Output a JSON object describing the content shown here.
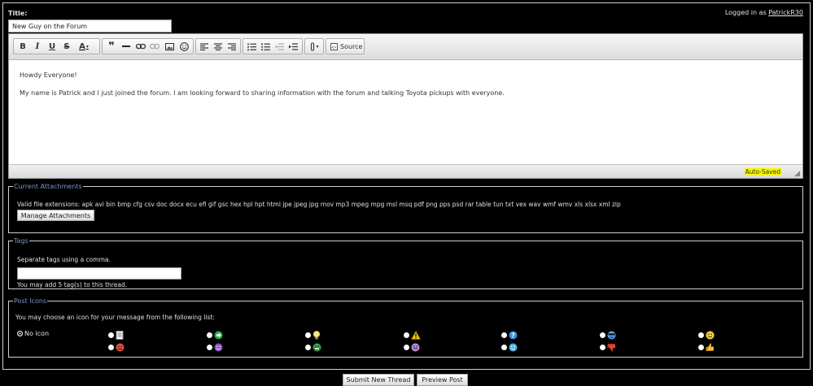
{
  "title_label": "Title:",
  "title_value": "New Guy on the Forum",
  "logged_in_prefix": "Logged in as",
  "username": "PatrickR30",
  "toolbar": {
    "bold": "B",
    "italic": "I",
    "underline": "U",
    "strike": "S",
    "color": "A",
    "quote": "❞",
    "source_label": "Source"
  },
  "editor": {
    "paragraphs": [
      "Howdy Everyone!",
      "My name is Patrick and I just joined the forum. I am looking forward to sharing information with the forum and talking Toyota pickups with everyone."
    ],
    "status": "Auto-Saved"
  },
  "attachments": {
    "legend": "Current Attachments",
    "extensions": "Valid file extensions: apk avi bin bmp cfg csv doc docx ecu efi gif gsc hex hpl hpt html jpe jpeg jpg mov mp3 mpeg mpg msl msq pdf png pps psd rar table tun txt vex wav wmf wmv xls xlsx xml zip",
    "manage_label": "Manage Attachments"
  },
  "tags": {
    "legend": "Tags",
    "hint": "Separate tags using a comma.",
    "limit": "You may add 5 tag(s) to this thread."
  },
  "post_icons": {
    "legend": "Post Icons",
    "prompt": "You may choose an icon for your message from the following list:",
    "no_icon_label": "No icon",
    "icons": [
      "page-icon",
      "green-arrow-icon",
      "lightbulb-icon",
      "warning-icon",
      "question-icon",
      "cool-smiley-icon",
      "smiley-icon",
      "angry-icon",
      "purple-smiley-icon",
      "grin-icon",
      "tongue-icon",
      "blue-smiley-icon",
      "thumbs-down-icon",
      "thumbs-up-icon"
    ]
  },
  "buttons": {
    "submit": "Submit New Thread",
    "preview": "Preview Post"
  }
}
